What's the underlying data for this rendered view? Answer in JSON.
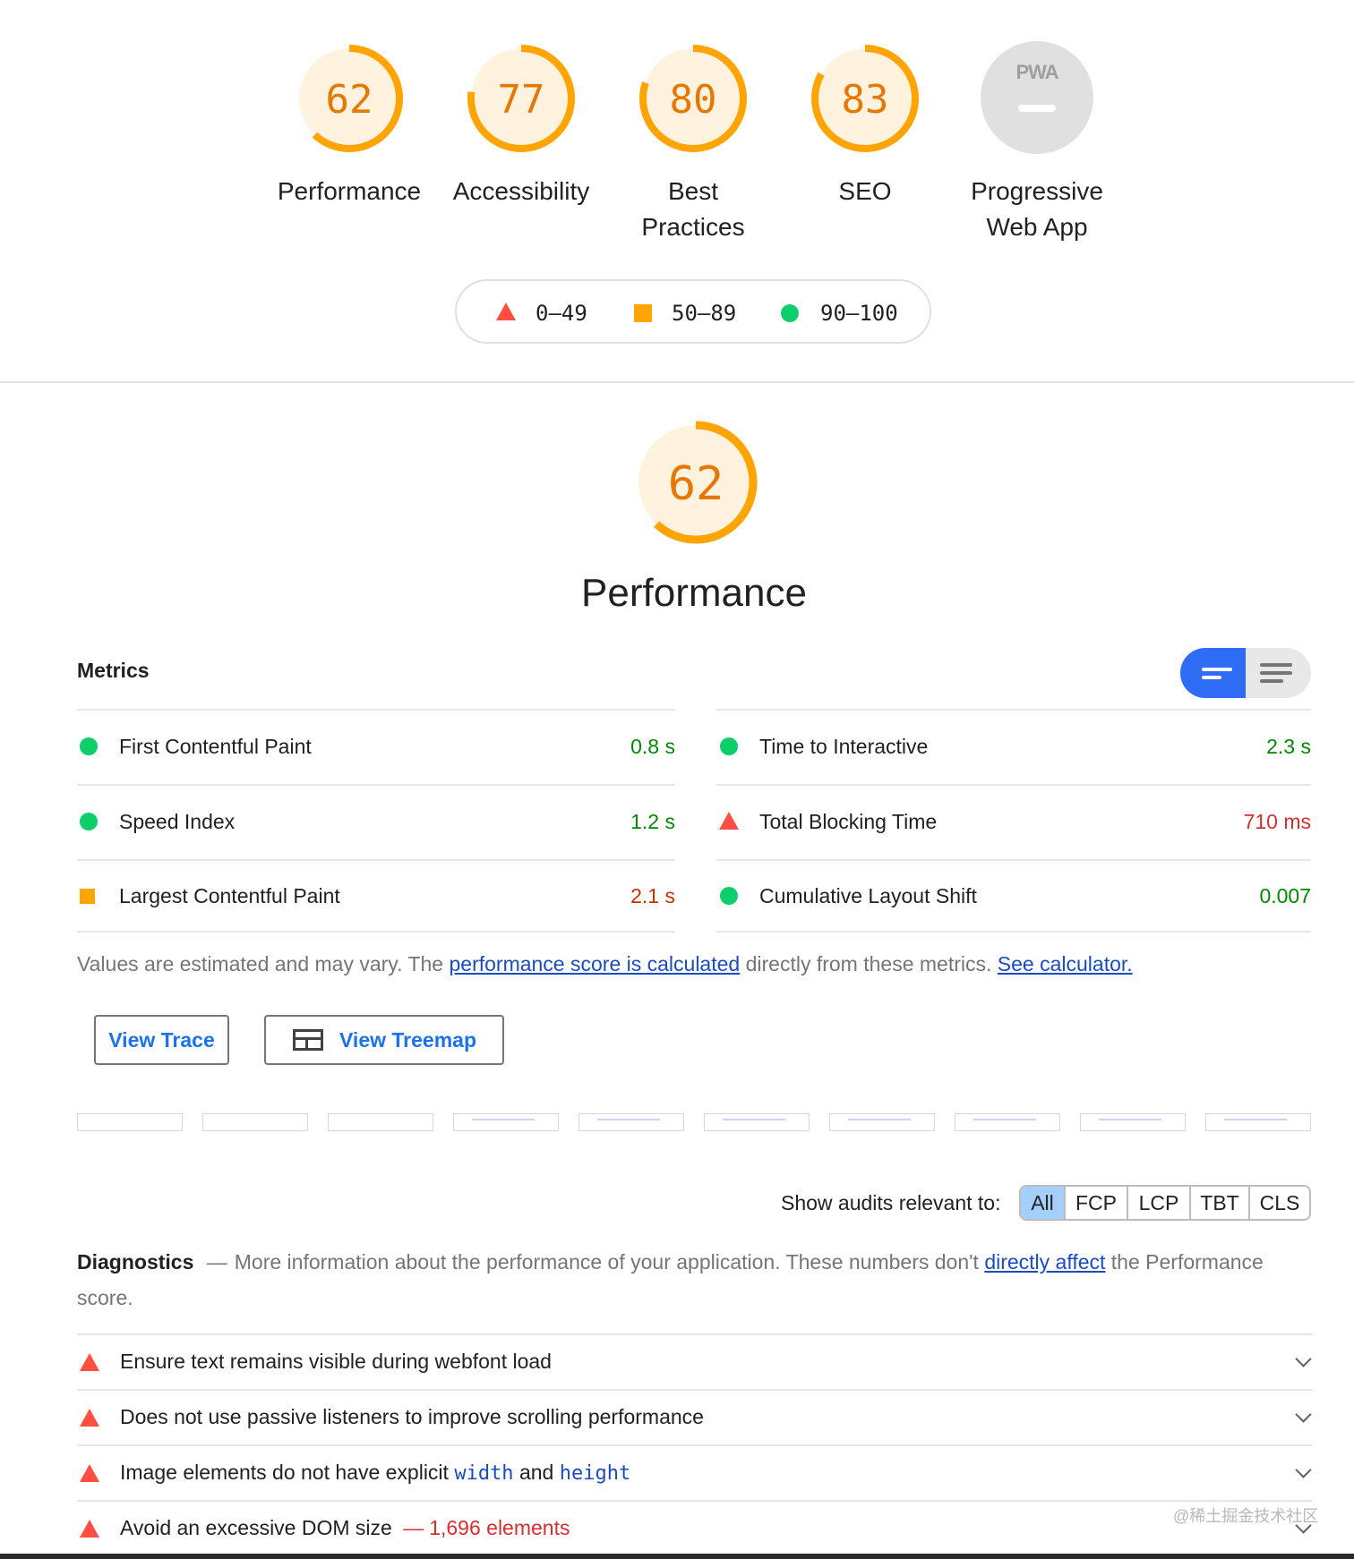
{
  "summary_gauges": [
    {
      "score": "62",
      "label": "Performance",
      "fraction": 0.62
    },
    {
      "score": "77",
      "label": "Accessibility",
      "fraction": 0.77
    },
    {
      "score": "80",
      "label": "Best Practices",
      "fraction": 0.8
    },
    {
      "score": "83",
      "label": "SEO",
      "fraction": 0.83
    }
  ],
  "pwa": {
    "badge_text": "PWA",
    "label": "Progressive Web App"
  },
  "legend": {
    "fail": "0–49",
    "average": "50–89",
    "pass": "90–100"
  },
  "colors": {
    "average": "#ffa400",
    "average_text": "#e67700",
    "pass": "#0cce6b",
    "pass_text": "#008800",
    "fail": "#ff4e42",
    "fail_text": "#d32f2f",
    "link": "#1a4cbf",
    "toggle": "#2f6cf6"
  },
  "performance": {
    "score": "62",
    "fraction": 0.62,
    "title": "Performance"
  },
  "metrics": {
    "heading": "Metrics",
    "left": [
      {
        "label": "First Contentful Paint",
        "value": "0.8 s",
        "status": "pass"
      },
      {
        "label": "Speed Index",
        "value": "1.2 s",
        "status": "pass"
      },
      {
        "label": "Largest Contentful Paint",
        "value": "2.1 s",
        "status": "average"
      }
    ],
    "right": [
      {
        "label": "Time to Interactive",
        "value": "2.3 s",
        "status": "pass"
      },
      {
        "label": "Total Blocking Time",
        "value": "710 ms",
        "status": "fail"
      },
      {
        "label": "Cumulative Layout Shift",
        "value": "0.007",
        "status": "pass"
      }
    ]
  },
  "note": {
    "prefix": "Values are estimated and may vary. The ",
    "link1": "performance score is calculated",
    "middle": " directly from these metrics. ",
    "link2": "See calculator."
  },
  "buttons": {
    "view_trace": "View Trace",
    "view_treemap": "View Treemap"
  },
  "filter": {
    "label": "Show audits relevant to:",
    "chips": [
      "All",
      "FCP",
      "LCP",
      "TBT",
      "CLS"
    ],
    "active": "All"
  },
  "diagnostics": {
    "title": "Diagnostics",
    "separator": "—",
    "desc_prefix": "More information about the performance of your application. These numbers don't ",
    "desc_link": "directly affect",
    "desc_suffix": " the Performance score.",
    "audits": [
      {
        "title": "Ensure text remains visible during webfont load"
      },
      {
        "title": "Does not use passive listeners to improve scrolling performance"
      },
      {
        "title_before": "Image elements do not have explicit ",
        "code1": "width",
        "title_mid": " and ",
        "code2": "height"
      },
      {
        "title": "Avoid an excessive DOM size",
        "separator": "—",
        "display_value": "1,696 elements"
      }
    ]
  },
  "watermark": "@稀土掘金技术社区"
}
